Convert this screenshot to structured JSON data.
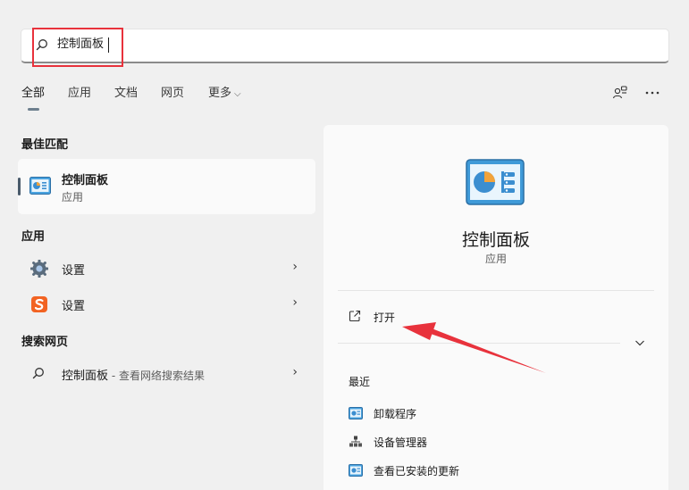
{
  "search": {
    "value": "控制面板"
  },
  "tabs": [
    {
      "label": "全部"
    },
    {
      "label": "应用"
    },
    {
      "label": "文档"
    },
    {
      "label": "网页"
    },
    {
      "label": "更多"
    }
  ],
  "best_match": {
    "section": "最佳匹配",
    "name": "控制面板",
    "type": "应用"
  },
  "apps": {
    "section": "应用",
    "items": [
      {
        "label": "设置",
        "icon": "settings-gear-icon"
      },
      {
        "label": "设置",
        "icon": "sogou-s-icon"
      }
    ]
  },
  "web": {
    "section": "搜索网页",
    "query": "控制面板",
    "suffix": " - 查看网络搜索结果"
  },
  "detail": {
    "title": "控制面板",
    "type": "应用",
    "open_label": "打开",
    "recent_label": "最近",
    "recent": [
      {
        "label": "卸载程序",
        "icon": "control-panel-icon"
      },
      {
        "label": "设备管理器",
        "icon": "device-manager-icon"
      },
      {
        "label": "查看已安装的更新",
        "icon": "control-panel-icon"
      }
    ]
  },
  "colors": {
    "highlight_box": "#e8323c",
    "annotation_arrow": "#e8323c",
    "accent": "#4a5b6b"
  }
}
